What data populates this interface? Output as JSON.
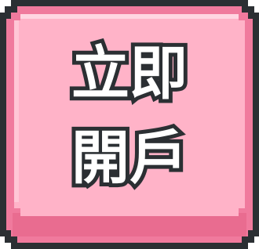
{
  "button": {
    "line1": "立即",
    "line2": "開戶"
  },
  "colors": {
    "outline": "#2b2f33",
    "face": "#ffb3c8",
    "border": "#f07a9d",
    "shadow": "#e96c90",
    "highlight": "#ffd6e2",
    "text": "#ffffff"
  }
}
